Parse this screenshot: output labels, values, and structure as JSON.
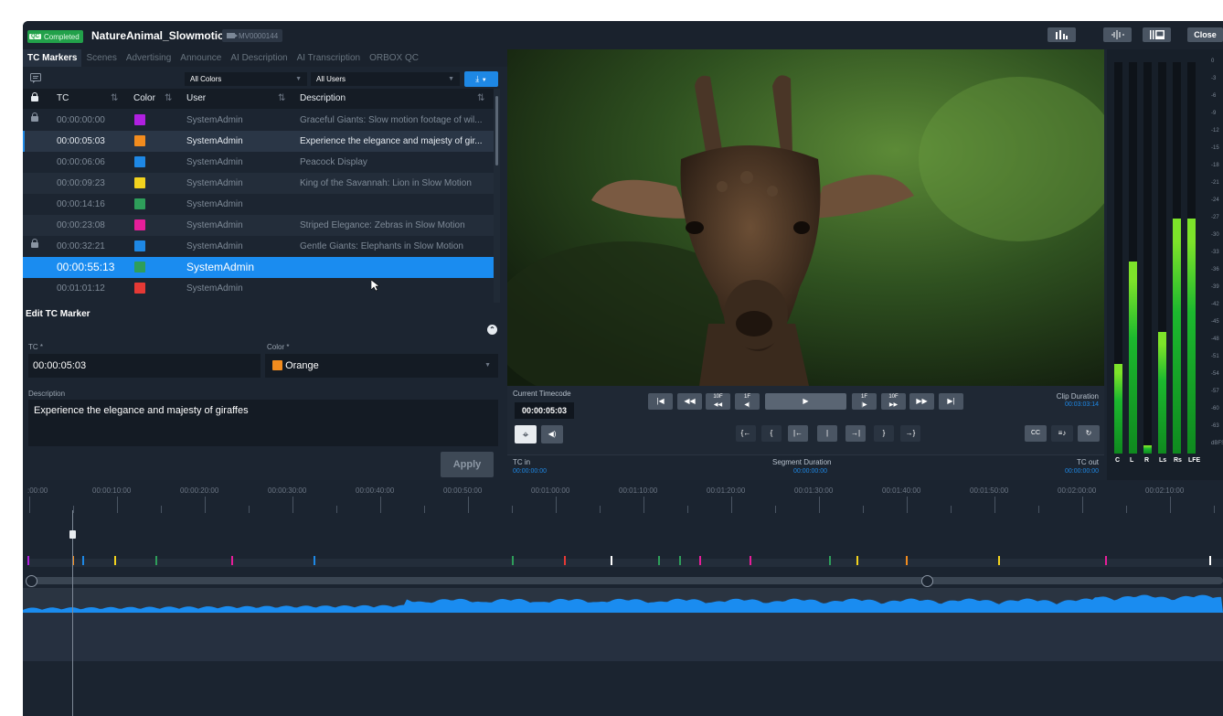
{
  "header": {
    "status_badge": "Completed",
    "status_icon_text": "QC",
    "title": "NatureAnimal_Slowmotion",
    "media_id": "MV0000144",
    "close_label": "Close"
  },
  "tabs": [
    "TC Markers",
    "Scenes",
    "Advertising",
    "Announce",
    "AI Description",
    "AI Transcription",
    "ORBOX QC"
  ],
  "filters": {
    "colors": "All Colors",
    "users": "All Users"
  },
  "table": {
    "headers": {
      "tc": "TC",
      "color": "Color",
      "user": "User",
      "description": "Description"
    },
    "rows": [
      {
        "tc": "00:00:00:00",
        "color": "#b020e0",
        "user": "SystemAdmin",
        "description": "Graceful Giants: Slow motion footage of wil...",
        "locked": true
      },
      {
        "tc": "00:00:05:03",
        "color": "#f28c1e",
        "user": "SystemAdmin",
        "description": "Experience the elegance and majesty of gir...",
        "locked": false
      },
      {
        "tc": "00:00:06:06",
        "color": "#1e88e5",
        "user": "SystemAdmin",
        "description": "Peacock Display",
        "locked": false
      },
      {
        "tc": "00:00:09:23",
        "color": "#f2d21e",
        "user": "SystemAdmin",
        "description": "King of the Savannah: Lion in Slow Motion",
        "locked": false
      },
      {
        "tc": "00:00:14:16",
        "color": "#2e9e5a",
        "user": "SystemAdmin",
        "description": "",
        "locked": false
      },
      {
        "tc": "00:00:23:08",
        "color": "#e61e9a",
        "user": "SystemAdmin",
        "description": "Striped Elegance: Zebras in Slow Motion",
        "locked": false
      },
      {
        "tc": "00:00:32:21",
        "color": "#1e88e5",
        "user": "SystemAdmin",
        "description": "Gentle Giants: Elephants in Slow Motion",
        "locked": true
      },
      {
        "tc": "00:00:55:13",
        "color": "#2e9e5a",
        "user": "SystemAdmin",
        "description": "",
        "locked": false
      },
      {
        "tc": "00:01:01:12",
        "color": "#e53935",
        "user": "SystemAdmin",
        "description": "",
        "locked": false
      }
    ]
  },
  "edit": {
    "title": "Edit TC Marker",
    "tc_label": "TC *",
    "tc_value": "00:00:05:03",
    "color_label": "Color *",
    "color_value": "Orange",
    "color_hex": "#f28c1e",
    "description_label": "Description",
    "description_value": "Experience the elegance and majesty of giraffes",
    "apply_label": "Apply"
  },
  "transport": {
    "current_tc_label": "Current Timecode",
    "current_tc": "00:00:05:03",
    "clip_duration_label": "Clip Duration",
    "clip_duration": "00:03:03:14",
    "tc_in_label": "TC in",
    "tc_in": "00:00:00:00",
    "segment_label": "Segment Duration",
    "segment": "00:00:00:00",
    "tc_out_label": "TC out",
    "tc_out": "00:00:00:00"
  },
  "meters": {
    "scale": [
      "0",
      "-3",
      "-6",
      "-9",
      "-12",
      "-15",
      "-18",
      "-21",
      "-24",
      "-27",
      "-30",
      "-33",
      "-36",
      "-39",
      "-42",
      "-45",
      "-48",
      "-51",
      "-54",
      "-57",
      "-60",
      "-63",
      "dBFS"
    ],
    "channels": [
      {
        "label": "C",
        "level": 0.23
      },
      {
        "label": "L",
        "level": 0.49
      },
      {
        "label": "R",
        "level": 0.02
      },
      {
        "label": "Ls",
        "level": 0.31
      },
      {
        "label": "Rs",
        "level": 0.6
      },
      {
        "label": "LFE",
        "level": 0.6
      }
    ]
  },
  "timeline": {
    "ruler": [
      ":00:00",
      "00:00:10:00",
      "00:00:20:00",
      "00:00:30:00",
      "00:00:40:00",
      "00:00:50:00",
      "00:01:00:00",
      "00:01:10:00",
      "00:01:20:00",
      "00:01:30:00",
      "00:01:40:00",
      "00:01:50:00",
      "00:02:00:00",
      "00:02:10:00"
    ]
  },
  "colors": {
    "accent": "#1e88e5",
    "background": "#1c2531",
    "status_green": "#22a14a"
  }
}
